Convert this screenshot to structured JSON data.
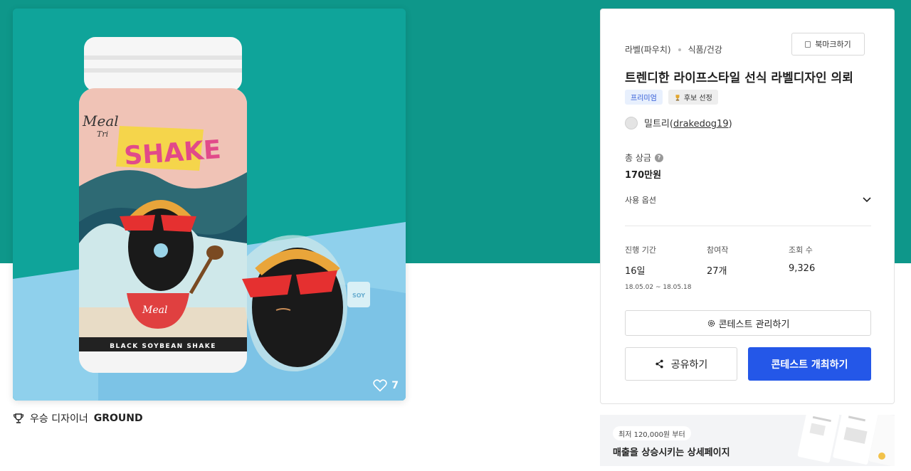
{
  "product": {
    "likes": "7",
    "winner_prefix": "우승 디자이너",
    "winner_name": "GROUND",
    "jar_brand": "Meal",
    "jar_brand_sub": "Tri",
    "jar_headline": "SHAKE",
    "jar_band_text": "BLACK SOYBEAN SHAKE",
    "mug_text": "SOY"
  },
  "contest": {
    "category": "라벨(파우치)",
    "subcategory": "식품/건강",
    "bookmark_label": "북마크하기",
    "title": "트렌디한 라이프스타일 선식 라벨디자인 의뢰",
    "badges": {
      "premium": "프리미엄",
      "candidate": "후보 선정"
    },
    "host_name": "밀트리",
    "host_handle_open": "(",
    "host_handle": "drakedog19",
    "host_handle_close": ")",
    "prize_label": "총 상금",
    "prize_value": "170만원",
    "usage_label": "사용 옵션",
    "stats": {
      "period_label": "진행 기간",
      "period_value": "16일",
      "period_dates": "18.05.02 ~ 18.05.18",
      "entries_label": "참여작",
      "entries_value": "27개",
      "views_label": "조회 수",
      "views_value": "9,326"
    },
    "manage_label": "콘테스트 관리하기",
    "share_label": "공유하기",
    "host_button_label": "콘테스트 개최하기"
  },
  "ad": {
    "pill": "최저 120,000원 부터",
    "title": "매출을 상승시키는 상세페이지"
  },
  "colors": {
    "teal": "#0e978a",
    "primary_blue": "#2457e8",
    "premium_text": "#2b56d6"
  }
}
